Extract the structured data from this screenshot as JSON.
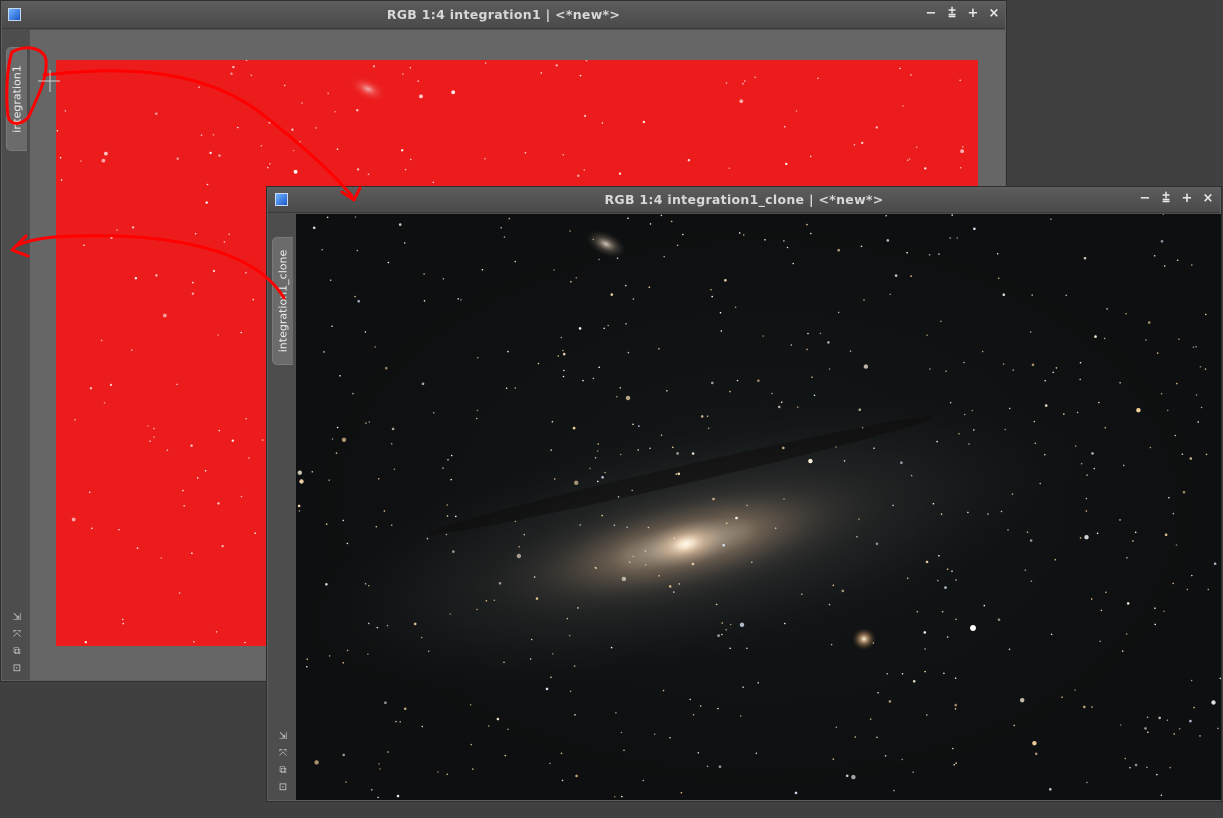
{
  "window_main": {
    "title": "RGB 1:4 integration1 | <*new*>",
    "tab_label": "integration1",
    "image_color": "#ec1c1c"
  },
  "window_clone": {
    "title": "RGB 1:4 integration1_clone | <*new*>",
    "tab_label": "integration1_clone"
  },
  "controls": {
    "minimize": "−",
    "shade": "⩲",
    "maximize": "+",
    "close": "×"
  },
  "side_tools": {
    "fit": "⇲",
    "zoom": "⤧",
    "copy": "⧉",
    "frame": "⊡"
  },
  "icons": [
    "app-icon",
    "minimize-icon",
    "shade-icon",
    "maximize-icon",
    "close-icon",
    "crosshair-cursor-icon"
  ],
  "colors": {
    "annotation": "#ff0000",
    "titlebar": "#535353",
    "image_background": "#101213"
  }
}
